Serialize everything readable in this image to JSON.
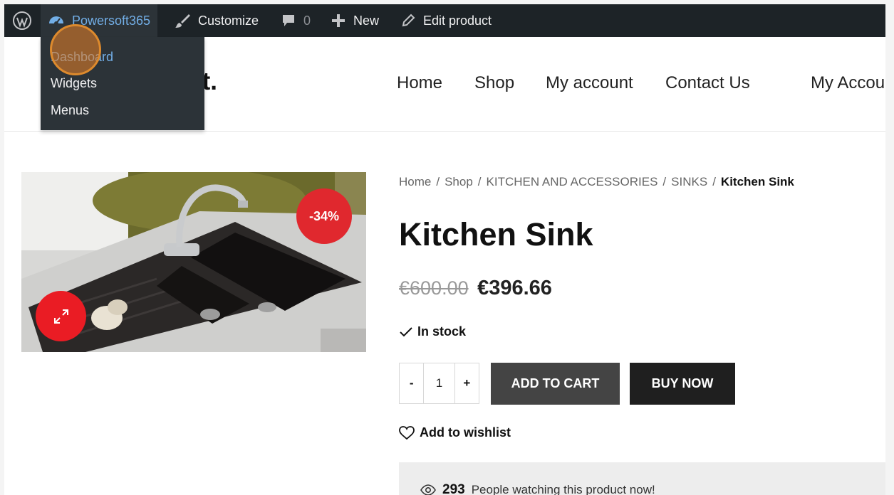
{
  "admin_bar": {
    "site_name": "Powersoft365",
    "customize": "Customize",
    "comments_count": "0",
    "new": "New",
    "edit": "Edit product"
  },
  "dropdown": {
    "items": [
      "Dashboard",
      "Widgets",
      "Menus"
    ]
  },
  "site": {
    "logo_text": "rt."
  },
  "nav": {
    "items": [
      "Home",
      "Shop",
      "My account",
      "Contact Us",
      "My Accou"
    ]
  },
  "breadcrumb": {
    "items": [
      "Home",
      "Shop",
      "KITCHEN AND ACCESSORIES",
      "SINKS"
    ],
    "current": "Kitchen Sink",
    "separator": "/"
  },
  "product": {
    "title": "Kitchen Sink",
    "badge": "-34%",
    "old_price": "€600.00",
    "price": "€396.66",
    "stock": "In stock",
    "quantity": "1",
    "minus": "-",
    "plus": "+",
    "add_to_cart": "ADD TO CART",
    "buy_now": "BUY NOW",
    "wishlist": "Add to wishlist",
    "watching_count": "293",
    "watching_text": "People watching this product now!"
  },
  "icons": {
    "wordpress": "wordpress-icon",
    "dashboard": "dashboard-icon",
    "brush": "brush-icon",
    "comment": "comment-icon",
    "plus": "plus-icon",
    "pencil": "pencil-icon",
    "expand": "expand-icon",
    "check": "check-icon",
    "heart": "heart-icon",
    "eye": "eye-icon"
  },
  "colors": {
    "admin_bar": "#1d2327",
    "admin_link": "#72aee6",
    "sale": "#e0282e",
    "cart_button": "#444444",
    "buy_button": "#1f1f1f"
  }
}
